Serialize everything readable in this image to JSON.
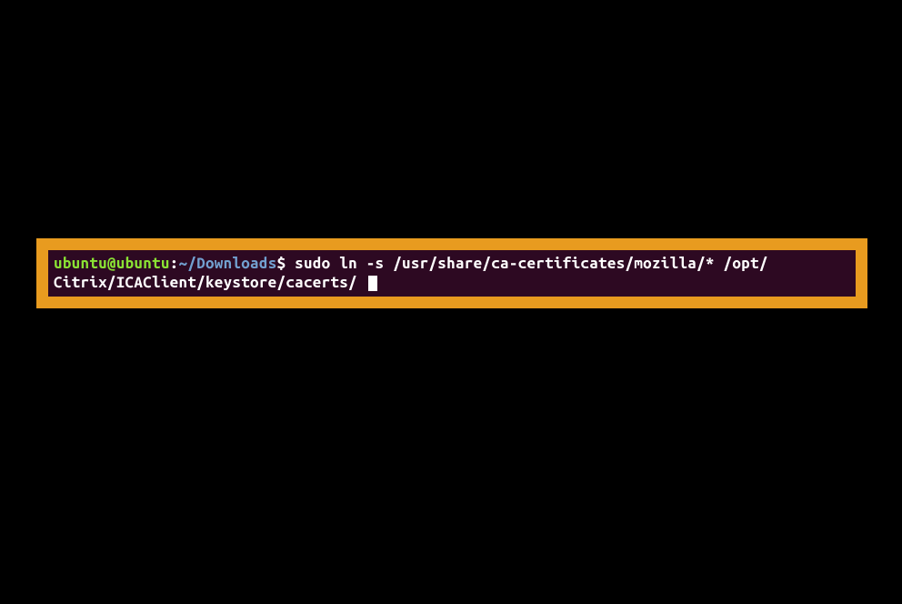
{
  "terminal": {
    "prompt": {
      "user": "ubuntu",
      "at": "@",
      "host": "ubuntu",
      "colon": ":",
      "path": "~/Downloads",
      "dollar": "$"
    },
    "command_line1": " sudo ln -s /usr/share/ca-certificates/mozilla/* /opt/",
    "command_line2": "Citrix/ICAClient/keystore/cacerts/ "
  },
  "colors": {
    "background": "#000000",
    "highlight_border": "#e89b1f",
    "terminal_bg": "#2d0922",
    "user_host": "#8ae234",
    "path": "#729fcf",
    "text": "#ffffff"
  }
}
